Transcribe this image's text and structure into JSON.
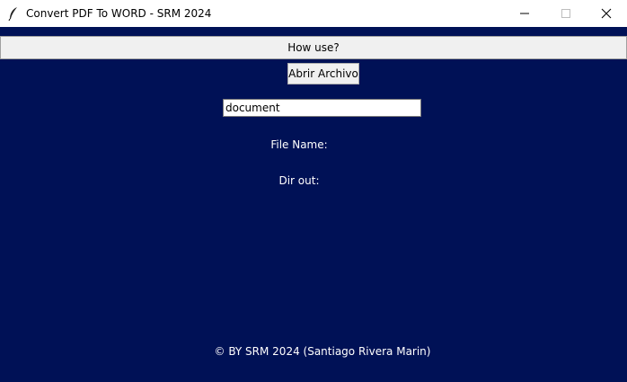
{
  "window": {
    "title": "Convert PDF To WORD - SRM 2024",
    "icon": "feather-icon",
    "controls": [
      "minimize-icon",
      "maximize-icon",
      "close-icon"
    ]
  },
  "menu": {
    "how_use_label": "How use?"
  },
  "main": {
    "open_button_label": "Abrir Archivo",
    "name_input_value": "document",
    "file_name_label": "File Name:",
    "dir_out_label": "Dir out:"
  },
  "footer": {
    "text": "© BY SRM 2024 (Santiago Rivera Marin)"
  },
  "colors": {
    "background": "#001156",
    "text": "#ffffff"
  }
}
